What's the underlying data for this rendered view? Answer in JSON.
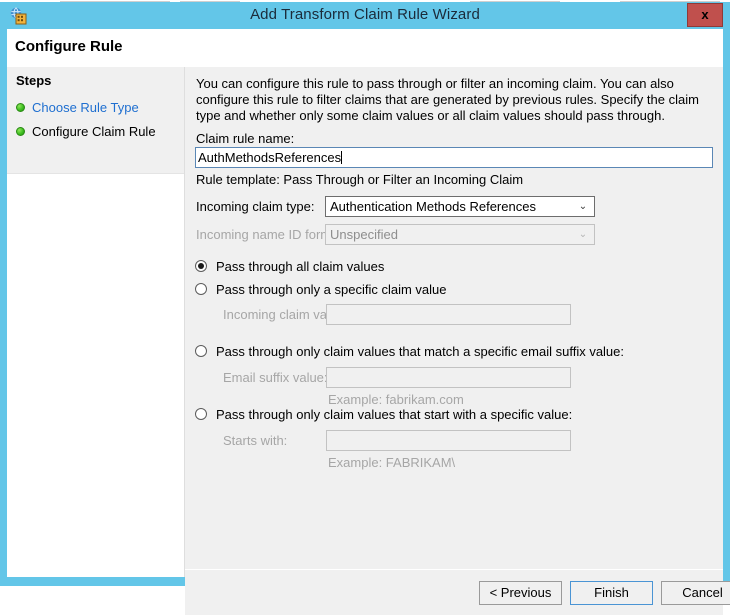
{
  "window": {
    "title": "Add Transform Claim Rule Wizard",
    "icon": "adfs-claim-rule-icon",
    "close_label": "x",
    "accent_color": "#63c6e8",
    "close_color": "#c0504d"
  },
  "header": {
    "title": "Configure Rule"
  },
  "sidebar": {
    "title": "Steps",
    "items": [
      {
        "label": "Choose Rule Type",
        "state": "link"
      },
      {
        "label": "Configure Claim Rule",
        "state": "current"
      }
    ]
  },
  "main": {
    "description": "You can configure this rule to pass through or filter an incoming claim. You can also configure this rule to filter claims that are generated by previous rules. Specify the claim type and whether only some claim values or all claim values should pass through.",
    "rule_name_label": "Claim rule name:",
    "rule_name_value": "AuthMethodsReferences",
    "rule_template_text": "Rule template: Pass Through or Filter an Incoming Claim",
    "incoming_claim_type_label": "Incoming claim type:",
    "incoming_claim_type_value": "Authentication Methods References",
    "incoming_name_id_label": "Incoming name ID format:",
    "incoming_name_id_value": "Unspecified",
    "dropdown_arrow": "⌄",
    "options": [
      {
        "id": "pass-all",
        "label": "Pass through all claim values",
        "selected": true
      },
      {
        "id": "pass-specific",
        "label": "Pass through only a specific claim value",
        "selected": false,
        "field_label": "Incoming claim value:",
        "field_value": ""
      },
      {
        "id": "pass-email-suffix",
        "label": "Pass through only claim values that match a specific email suffix value:",
        "selected": false,
        "field_label": "Email suffix value:",
        "field_value": "",
        "example": "Example: fabrikam.com"
      },
      {
        "id": "pass-starts-with",
        "label": "Pass through only claim values that start with a specific value:",
        "selected": false,
        "field_label": "Starts with:",
        "field_value": "",
        "example": "Example: FABRIKAM\\"
      }
    ]
  },
  "buttons": {
    "previous": "< Previous",
    "finish": "Finish",
    "cancel": "Cancel"
  }
}
